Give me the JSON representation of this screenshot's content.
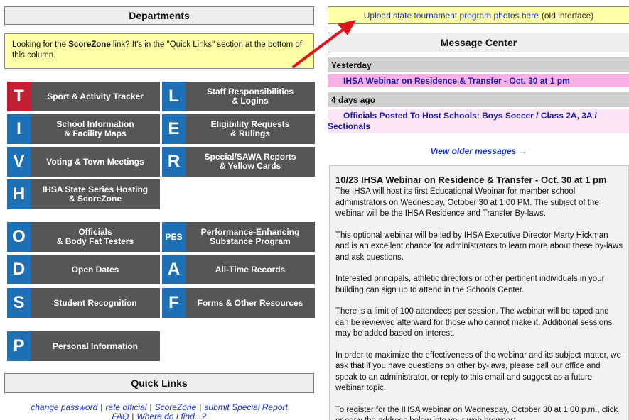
{
  "departments": {
    "heading": "Departments",
    "notice_pre": "Looking for the ",
    "notice_bold": "ScoreZone",
    "notice_post": " link? It's in the \"Quick Links\" section at the bottom of this column."
  },
  "tiles": [
    {
      "letter": "T",
      "line1": "Sport & Activity Tracker",
      "line2": ""
    },
    {
      "letter": "L",
      "line1": "Staff Responsibilities",
      "line2": "& Logins"
    },
    {
      "letter": "I",
      "line1": "School Information",
      "line2": "& Facility Maps"
    },
    {
      "letter": "E",
      "line1": "Eligibility Requests",
      "line2": "& Rulings"
    },
    {
      "letter": "V",
      "line1": "Voting & Town Meetings",
      "line2": ""
    },
    {
      "letter": "R",
      "line1": "Special/SAWA Reports",
      "line2": "& Yellow Cards"
    },
    {
      "letter": "H",
      "line1": "IHSA State Series Hosting",
      "line2": "& ScoreZone"
    },
    {
      "letter": "O",
      "line1": "Officials",
      "line2": "& Body Fat Testers"
    },
    {
      "letter": "PES",
      "line1": "Performance-Enhancing",
      "line2": "Substance Program"
    },
    {
      "letter": "D",
      "line1": "Open Dates",
      "line2": ""
    },
    {
      "letter": "A",
      "line1": "All-Time Records",
      "line2": ""
    },
    {
      "letter": "S",
      "line1": "Student Recognition",
      "line2": ""
    },
    {
      "letter": "F",
      "line1": "Forms & Other Resources",
      "line2": ""
    },
    {
      "letter": "P",
      "line1": "Personal Information",
      "line2": ""
    }
  ],
  "quick_links": {
    "heading": "Quick Links",
    "row1": [
      "change password",
      "rate official",
      "ScoreZone",
      "submit Special Report"
    ],
    "row2": [
      "FAQ",
      "Where do I find...?"
    ]
  },
  "upload": {
    "link": "Upload state tournament program photos here",
    "suffix": "(old interface)"
  },
  "message_center": {
    "heading": "Message Center",
    "groups": [
      {
        "day": "Yesterday",
        "message": "IHSA Webinar on Residence & Transfer - Oct. 30 at 1 pm"
      },
      {
        "day": "4 days ago",
        "message": "Officials Posted To Host Schools: Boys Soccer / Class 2A, 3A / Sectionals"
      }
    ],
    "older_link": "View older messages →"
  },
  "article": {
    "title": "10/23  IHSA Webinar on Residence & Transfer - Oct. 30 at 1 pm",
    "paragraphs": [
      "The IHSA will host its first Educational Webinar for member school administrators on Wednesday, October 30 at 1:00 PM. The subject of the webinar will be the IHSA Residence and Transfer By-laws.",
      "This optional webinar will be led by IHSA Executive Director Marty Hickman and is an excellent chance for administrators to learn more about these by-laws and ask questions.",
      "Interested principals, athletic directors or other pertinent individuals in your building can sign up to attend in the Schools Center.",
      "There is a limit of 100 attendees per session. The webinar will be taped and can be reviewed afterward for those who cannot make it. Additional sessions may be added based on interest.",
      "In order to maximize the effectiveness of the webinar and its subject matter, we ask that if you have questions on other by-laws, please call our office and speak to an administrator, or reply to this email and suggest as a future webinar topic.",
      "To register for the IHSA webinar on Wednesday, October 30 at 1:00 p.m., click or copy the address below into your web browser:"
    ]
  },
  "colors": {
    "tile_gray": "#565656",
    "letter_red": "#c42033",
    "letter_blue": "#1f6fb5",
    "notice_yellow": "#ffffa8",
    "message_pink": "#f7b0e4",
    "arrow_red": "#e0141e"
  }
}
